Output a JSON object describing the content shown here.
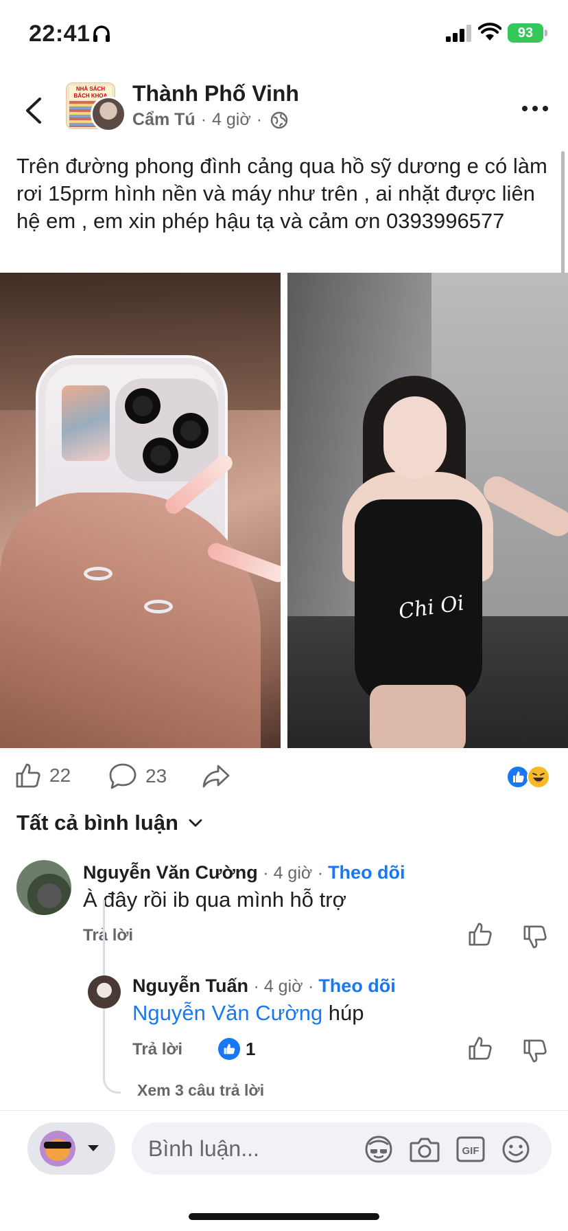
{
  "status_bar": {
    "time": "22:41",
    "battery": "93"
  },
  "header": {
    "group_name": "Thành Phố Vinh",
    "author": "Cẩm Tú",
    "time": "4 giờ",
    "group_logo_text": "NHÀ SÁCH BÁCH KHOA"
  },
  "post": {
    "text": "Trên đường phong đình cảng qua hồ sỹ dương e có làm rơi 15prm hình nền và máy như trên , ai nhặt được liên hệ em , em xin phép hậu tạ và cảm ơn 0393996577",
    "photo_watermark": "Chi Oi"
  },
  "actions": {
    "likes": "22",
    "comments": "23"
  },
  "comments_section": {
    "filter_label": "Tất cả bình luận",
    "comments": [
      {
        "name": "Nguyễn Văn Cường",
        "time": "4 giờ",
        "follow": "Theo dõi",
        "text": "À đây rồi ib qua mình hỗ trợ",
        "reply_label": "Trả lời"
      },
      {
        "name": "Nguyễn Tuấn",
        "time": "4 giờ",
        "follow": "Theo dõi",
        "mention": "Nguyễn Văn Cường",
        "text": " húp",
        "reply_label": "Trả lời",
        "likes": "1"
      }
    ],
    "view_replies": "Xem 3 câu trả lời"
  },
  "composer": {
    "placeholder": "Bình luận..."
  },
  "colors": {
    "accent": "#1877f2",
    "battery": "#34c759",
    "muted": "#65676b"
  }
}
